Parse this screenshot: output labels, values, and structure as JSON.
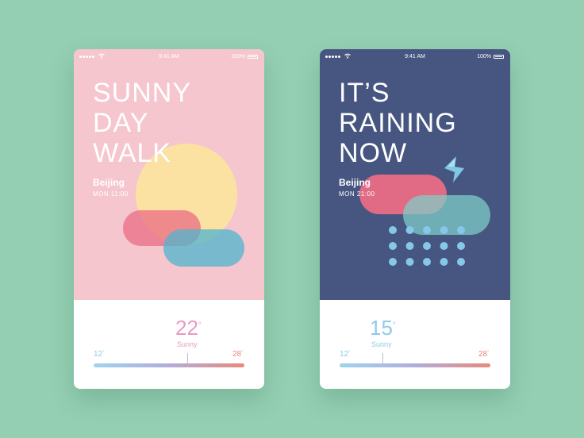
{
  "cards": [
    {
      "status": {
        "time": "9:41 AM",
        "battery": "100%"
      },
      "headline": [
        "SUNNY",
        "DAY",
        "WALK"
      ],
      "city": "Beijing",
      "datetime": "MON 11:00",
      "temperature": {
        "value": "22",
        "unit": "°",
        "color": "#e99ac0"
      },
      "condition": "Sunny",
      "range": {
        "low": "12",
        "high": "28",
        "unit": "°",
        "current_fraction": 0.62
      }
    },
    {
      "status": {
        "time": "9:41 AM",
        "battery": "100%"
      },
      "headline": [
        "IT’S",
        "RAINING",
        "NOW"
      ],
      "city": "Beijing",
      "datetime": "MON 21:00",
      "temperature": {
        "value": "15",
        "unit": "°",
        "color": "#8fcbe9"
      },
      "condition": "Sunny",
      "range": {
        "low": "12",
        "high": "28",
        "unit": "°",
        "current_fraction": 0.29
      }
    }
  ],
  "colors": {
    "background": "#94cfb3",
    "sunny_panel": "#f6c6ce",
    "rainy_panel": "#465680",
    "sun": "#fbe49f",
    "cloud_red": "#ea6c84",
    "cloud_blue": "#6fbfd1",
    "rain_drop": "#86c7ea",
    "range_low": "#9fd4ef",
    "range_high": "#e68a7c"
  },
  "icons": [
    "signal-dots-icon",
    "wifi-icon",
    "battery-icon",
    "sun-icon",
    "cloud-icon",
    "lightning-icon",
    "raindrop-icon"
  ]
}
